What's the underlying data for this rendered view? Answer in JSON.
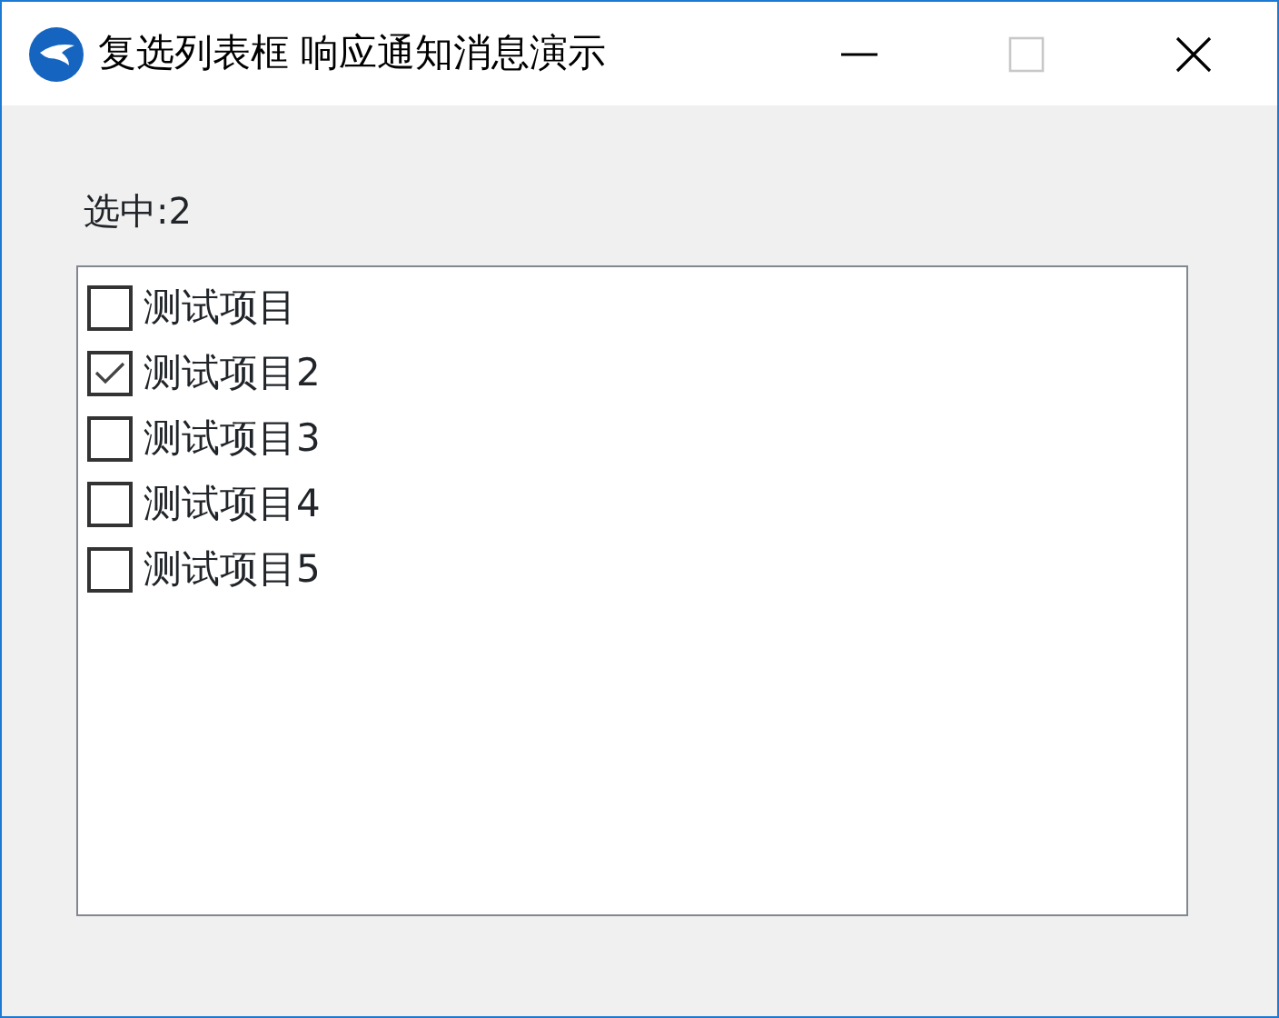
{
  "window": {
    "title": "复选列表框 响应通知消息演示",
    "maximize_disabled": true
  },
  "selection_label": "选中:2",
  "items": [
    {
      "label": "测试项目",
      "checked": false
    },
    {
      "label": "测试项目2",
      "checked": true
    },
    {
      "label": "测试项目3",
      "checked": false
    },
    {
      "label": "测试项目4",
      "checked": false
    },
    {
      "label": "测试项目5",
      "checked": false
    }
  ]
}
